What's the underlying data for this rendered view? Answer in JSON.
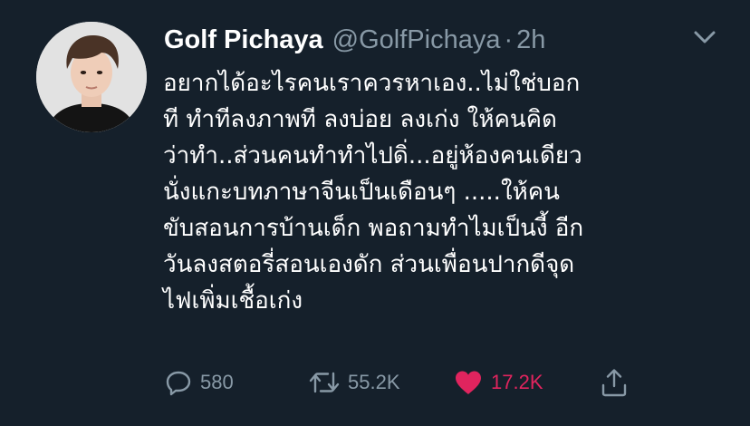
{
  "tweet": {
    "display_name": "Golf Pichaya",
    "handle": "@GolfPichaya",
    "separator": "·",
    "time": "2h",
    "text_lines": [
      "อยากได้อะไรคนเราควรหาเอง..ไม่ใช่บอก",
      "ที ทำทีลงภาพที ลงบ่อย ลงเก่ง ให้คนคิด",
      "ว่าทำ..ส่วนคนทำทำไปดิ่...อยู่ห้องคนเดียว",
      "นั่งแกะบทภาษาจีนเป็นเดือนๆ .....ให้คน",
      "ขับสอนการบ้านเด็ก พอถามทำไมเป็นงี้ อีก",
      "วันลงสตอรี่สอนเองดัก ส่วนเพื่อนปากดีจุด",
      "ไฟเพิ่มเชื้อเก่ง"
    ],
    "actions": {
      "reply": {
        "icon": "reply-icon",
        "count": "580"
      },
      "retweet": {
        "icon": "retweet-icon",
        "count": "55.2K"
      },
      "like": {
        "icon": "heart-icon",
        "count": "17.2K",
        "liked": true
      },
      "share": {
        "icon": "share-icon"
      }
    },
    "more_icon": "chevron-down-icon"
  },
  "colors": {
    "background": "#15202b",
    "text": "#ffffff",
    "secondary": "#8899a6",
    "like": "#e0245e"
  }
}
